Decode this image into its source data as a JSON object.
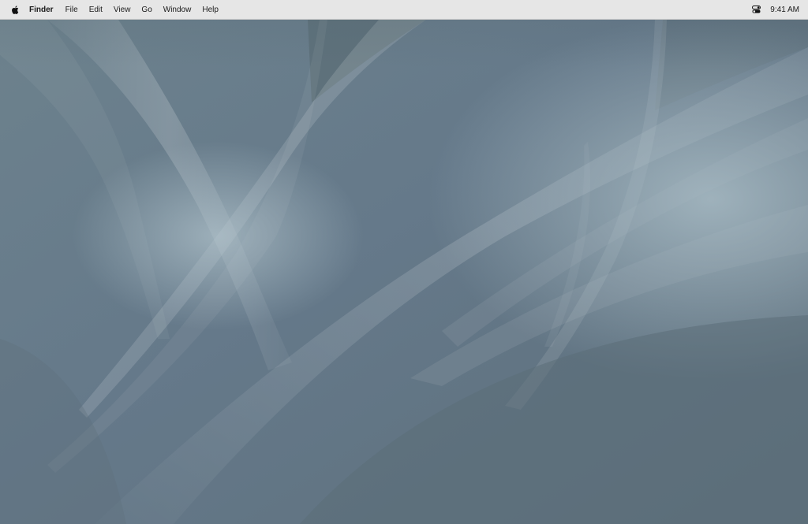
{
  "menubar": {
    "apple_icon": "apple-logo-icon",
    "app_name": "Finder",
    "menus": [
      "File",
      "Edit",
      "View",
      "Go",
      "Window",
      "Help"
    ],
    "status_icons": [
      "control-center-icon"
    ],
    "clock": "9:41 AM"
  },
  "desktop": {
    "wallpaper_base_color": "#657984",
    "wallpaper_highlight_color": "#a9bcc5"
  }
}
